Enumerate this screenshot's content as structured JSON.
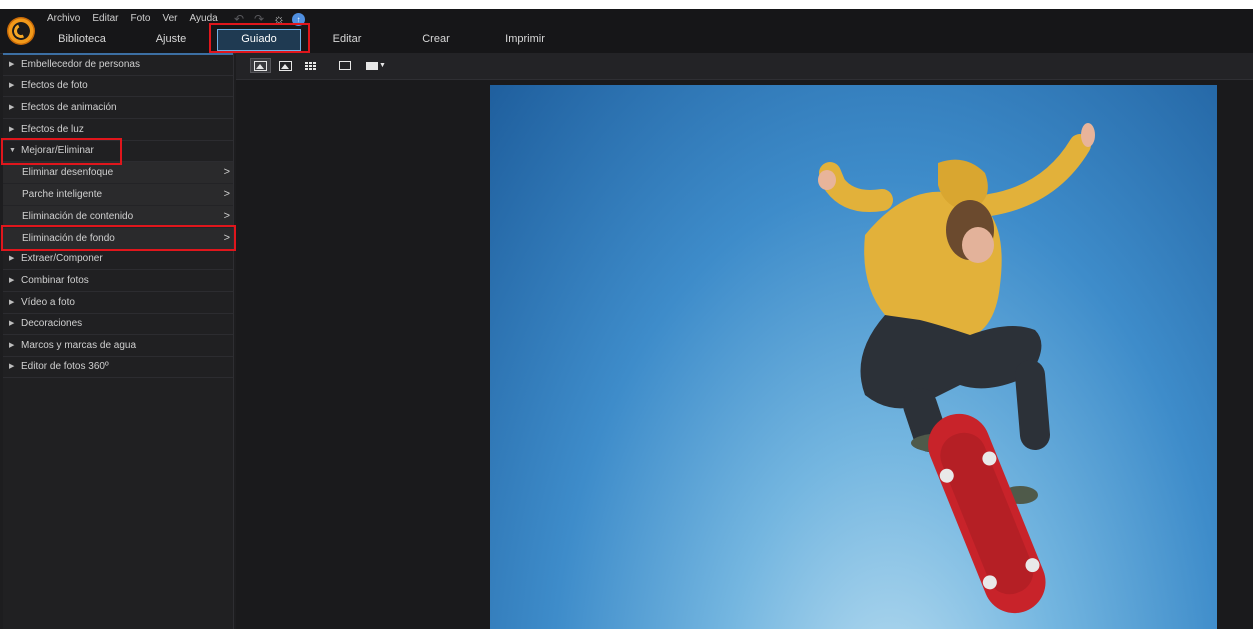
{
  "menu": [
    "Archivo",
    "Editar",
    "Foto",
    "Ver",
    "Ayuda"
  ],
  "quick_icons": [
    "undo-icon",
    "redo-icon",
    "settings-icon",
    "update-icon"
  ],
  "tabs": [
    "Biblioteca",
    "Ajuste",
    "Guiado",
    "Editar",
    "Crear",
    "Imprimir"
  ],
  "active_tab": "Guiado",
  "sidebar": {
    "items": [
      "Embellecedor de personas",
      "Efectos de foto",
      "Efectos de animación",
      "Efectos de luz",
      "Mejorar/Eliminar"
    ],
    "subitems": [
      "Eliminar desenfoque",
      "Parche inteligente",
      "Eliminación de contenido",
      "Eliminación de fondo"
    ],
    "items_after": [
      "Extraer/Componer",
      "Combinar fotos",
      "Vídeo a foto",
      "Decoraciones",
      "Marcos y marcas de agua",
      "Editor de fotos 360º"
    ],
    "expanded_item": "Mejorar/Eliminar"
  },
  "toolbar_icons": [
    "compare-view-icon",
    "single-view-icon",
    "grid-view-icon",
    "fit-window-icon",
    "display-menu-icon"
  ],
  "colors": {
    "highlight": "#e0161c",
    "active_tab_border": "#6fb0e6",
    "sky_top": "#1f5f9e",
    "sky_bottom": "#b7dcf0",
    "hoodie": "#e2b13a",
    "skateboard": "#c8232a"
  }
}
